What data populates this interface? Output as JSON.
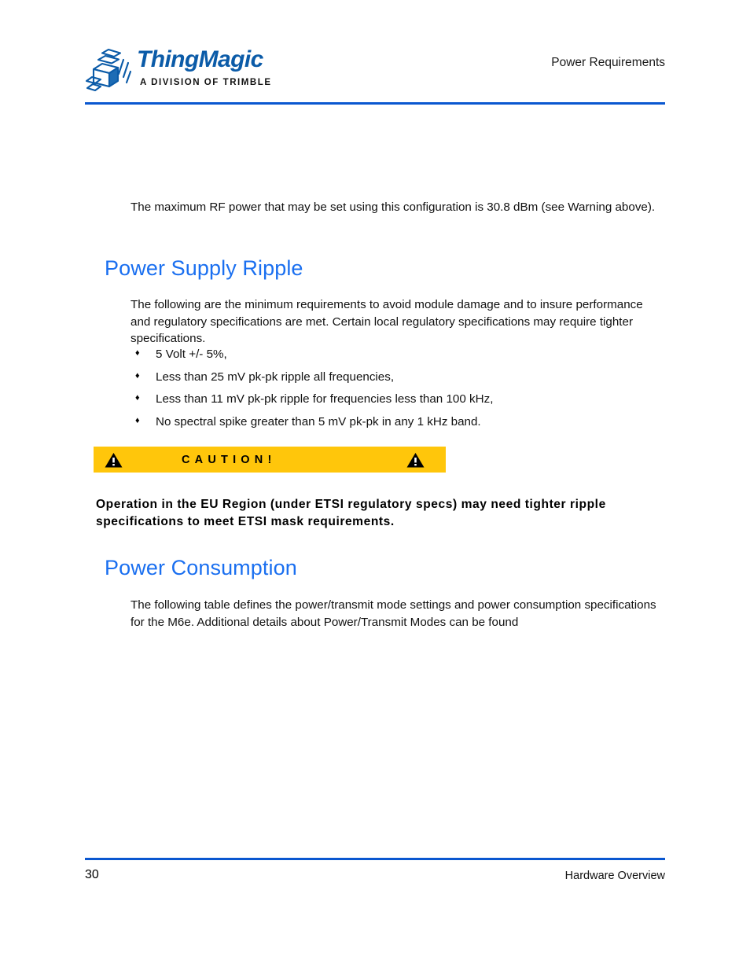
{
  "header": {
    "logo_word": "ThingMagic",
    "logo_tagline": "A DIVISION OF TRIMBLE",
    "running_title": "Power Requirements"
  },
  "footer": {
    "page_number": "30",
    "section": "Hardware Overview"
  },
  "colors": {
    "heading_blue": "#1a6ff0",
    "rule_blue": "#0a57d0",
    "logo_blue": "#0b5ba8",
    "caution_yellow": "#ffc60b"
  },
  "content": {
    "intro_paragraph": "The maximum RF power that may be set using this configuration is 30.8 dBm (see Warning above).",
    "section_ripple": {
      "heading": "Power Supply Ripple",
      "paragraph": "The following are the minimum requirements to avoid module damage and to insure performance and regulatory specifications are met. Certain local regulatory specifications may require tighter specifications.",
      "bullets": [
        "5 Volt +/- 5%,",
        "Less than 25 mV pk-pk ripple all frequencies,",
        "Less than 11 mV pk-pk ripple for frequencies less than 100 kHz,",
        "No spectral spike greater than 5 mV pk-pk in any 1 kHz band."
      ],
      "bullet_marker": "♦"
    },
    "caution": {
      "label": "CAUTION!",
      "body": "Operation in the EU Region (under ETSI regulatory specs) may need tighter ripple specifications to meet ETSI mask requirements."
    },
    "section_consumption": {
      "heading": "Power Consumption",
      "paragraph": "The following table defines the power/transmit mode settings and power consumption specifications for the M6e. Additional details about Power/Transmit Modes can be found"
    }
  }
}
